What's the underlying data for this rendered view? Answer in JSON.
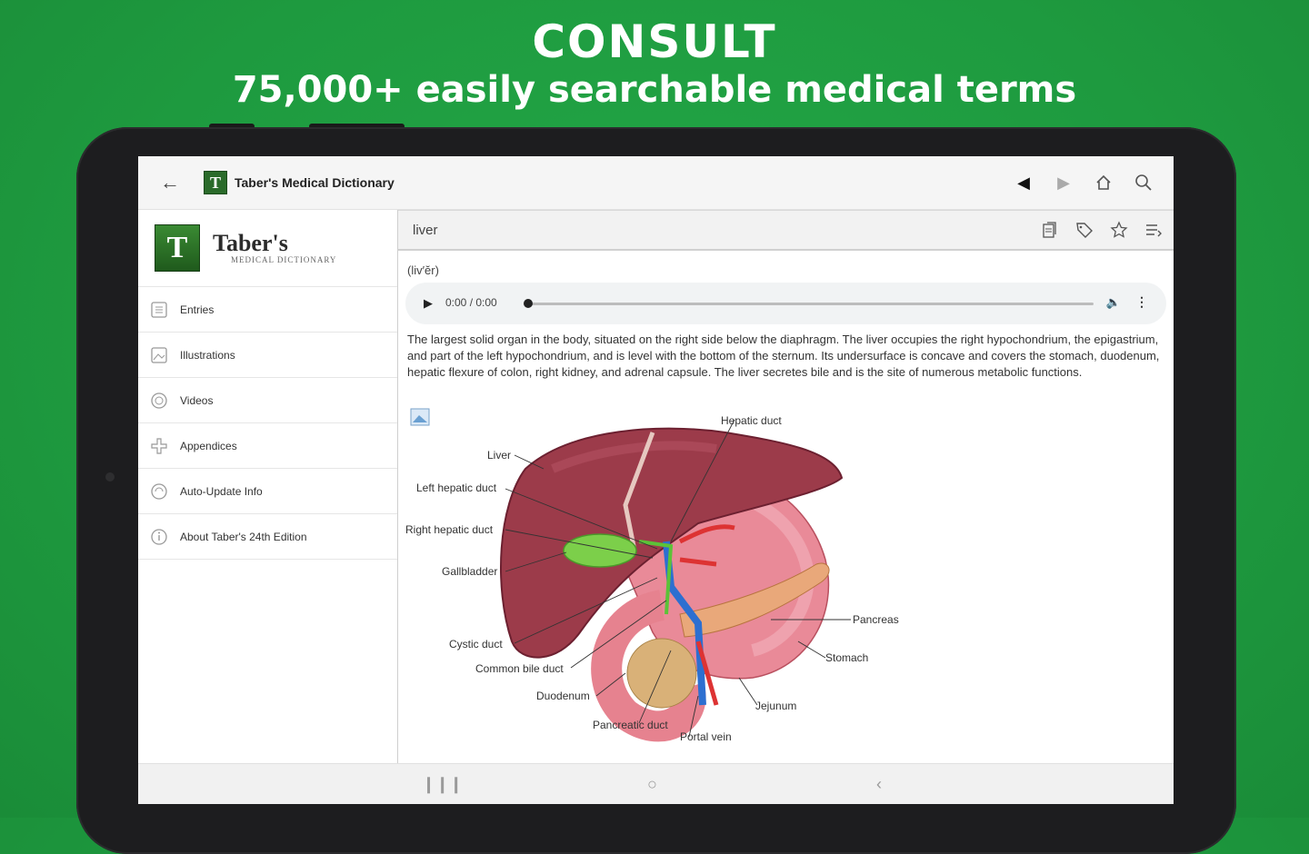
{
  "headline": {
    "title": "CONSULT",
    "subtitle": "75,000+ easily searchable medical terms"
  },
  "app": {
    "title": "Taber's Medical Dictionary",
    "logo_letter": "T",
    "topbar_icons": [
      "arrow-left-icon",
      "chevron-left-icon",
      "chevron-right-icon",
      "home-icon",
      "search-icon"
    ]
  },
  "sidebar": {
    "brand_title": "Taber's",
    "brand_subtitle": "MEDICAL DICTIONARY",
    "items": [
      {
        "label": "Entries",
        "icon": "list-icon"
      },
      {
        "label": "Illustrations",
        "icon": "image-icon"
      },
      {
        "label": "Videos",
        "icon": "video-icon"
      },
      {
        "label": "Appendices",
        "icon": "plus-cross-icon"
      },
      {
        "label": "Auto-Update Info",
        "icon": "sync-icon"
      },
      {
        "label": "About Taber's 24th Edition",
        "icon": "info-icon"
      }
    ]
  },
  "entry": {
    "term": "liver",
    "pronunciation": "(liv′ĕr)",
    "audio_time": "0:00 / 0:00",
    "definition": "The largest solid organ in the body, situated on the right side below the diaphragm. The liver occupies the right hypochondrium, the epigastrium, and part of the left hypochondrium, and is level with the bottom of the sternum. Its undersurface is concave and covers the stomach, duodenum, hepatic flexure of colon, right kidney, and adrenal capsule. The liver secretes bile and is the site of numerous metabolic functions.",
    "figure_labels": {
      "hepatic_duct": "Hepatic duct",
      "liver": "Liver",
      "left_hepatic_duct": "Left hepatic duct",
      "right_hepatic_duct": "Right hepatic duct",
      "gallbladder": "Gallbladder",
      "cystic_duct": "Cystic duct",
      "common_bile_duct": "Common bile duct",
      "duodenum": "Duodenum",
      "pancreatic_duct": "Pancreatic duct",
      "portal_vein": "Portal vein",
      "jejunum": "Jejunum",
      "stomach": "Stomach",
      "pancreas": "Pancreas"
    }
  }
}
